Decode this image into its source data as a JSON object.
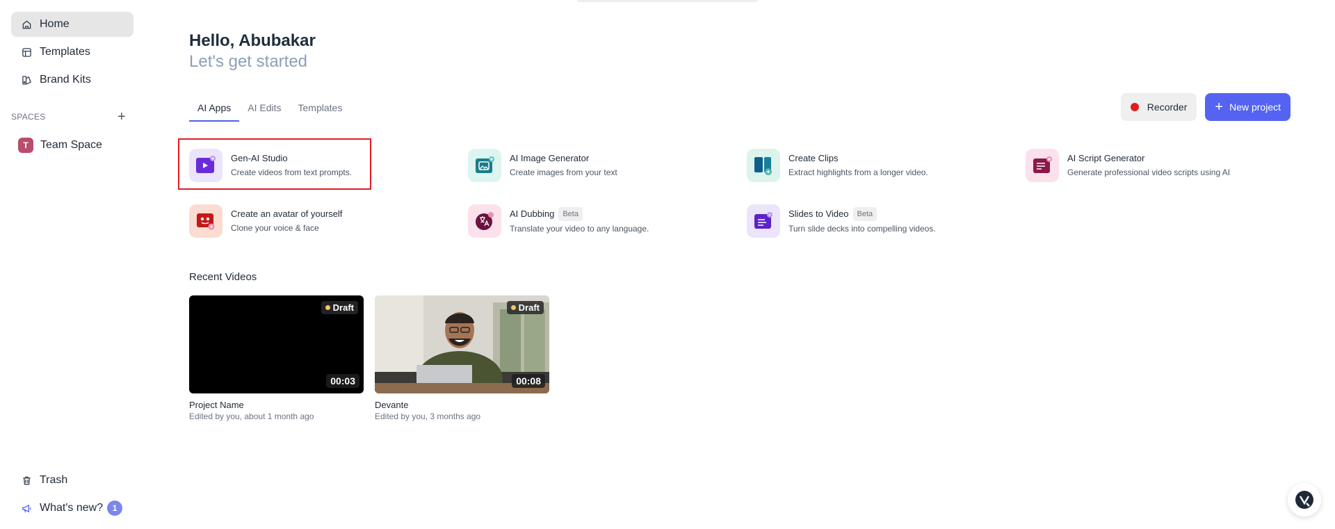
{
  "sidebar": {
    "nav": [
      {
        "label": "Home",
        "icon": "home-icon",
        "active": true
      },
      {
        "label": "Templates",
        "icon": "templates-icon"
      },
      {
        "label": "Brand Kits",
        "icon": "brand-kits-icon"
      }
    ],
    "spaces_label": "SPACES",
    "spaces_add": "+",
    "spaces": [
      {
        "initial": "T",
        "label": "Team Space",
        "color": "#b84d6d"
      }
    ],
    "bottom": {
      "trash": "Trash",
      "whats_new": "What's new?",
      "whats_new_count": "1"
    }
  },
  "header": {
    "greeting": "Hello, Abubakar",
    "subtitle": "Let's get started"
  },
  "tabs": [
    "AI Apps",
    "AI Edits",
    "Templates"
  ],
  "actions": {
    "recorder": "Recorder",
    "new_project": "New project",
    "new_project_icon": "+",
    "accent": "#5464f1"
  },
  "apps": [
    {
      "title": "Gen-AI Studio",
      "desc": "Create videos from text prompts.",
      "icon": "gen-ai-studio-icon"
    },
    {
      "title": "AI Image Generator",
      "desc": "Create images from your text",
      "icon": "image-generator-icon"
    },
    {
      "title": "Create Clips",
      "desc": "Extract highlights from a longer video.",
      "icon": "create-clips-icon"
    },
    {
      "title": "AI Script Generator",
      "desc": "Generate professional video scripts using AI",
      "icon": "script-generator-icon"
    },
    {
      "title": "Create an avatar of yourself",
      "desc": "Clone your voice & face",
      "icon": "avatar-icon"
    },
    {
      "title": "AI Dubbing",
      "desc": "Translate your video to any language.",
      "icon": "dubbing-icon",
      "badge": "Beta"
    },
    {
      "title": "Slides to Video",
      "desc": "Turn slide decks into compelling videos.",
      "icon": "slides-icon",
      "badge": "Beta"
    }
  ],
  "recent": {
    "title": "Recent Videos",
    "videos": [
      {
        "name": "Project Name",
        "meta": "Edited by you, about 1 month ago",
        "status": "Draft",
        "duration": "00:03"
      },
      {
        "name": "Devante",
        "meta": "Edited by you, 3 months ago",
        "status": "Draft",
        "duration": "00:08"
      }
    ]
  }
}
